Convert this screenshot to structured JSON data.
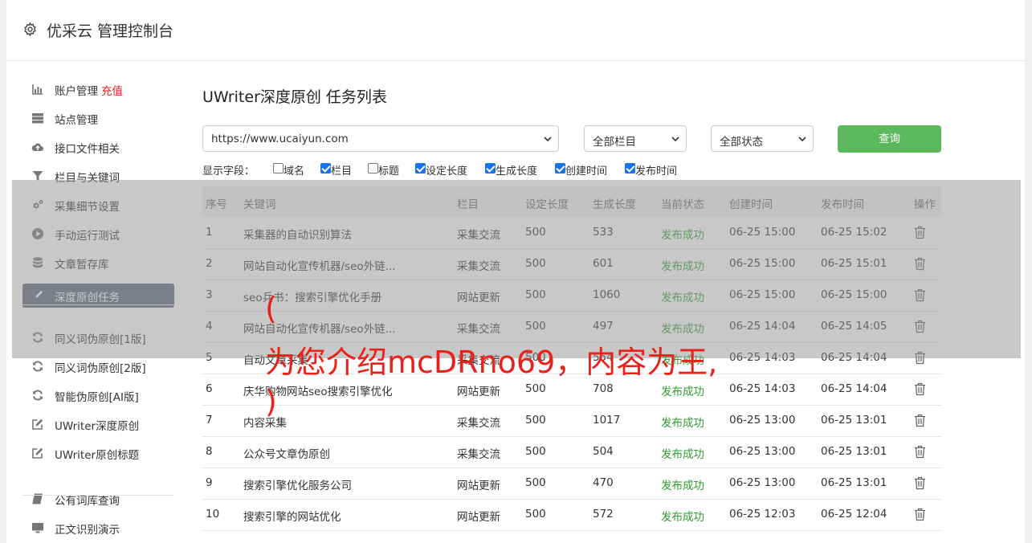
{
  "header": {
    "title": "优采云 管理控制台"
  },
  "sidebar": {
    "items": [
      {
        "label": "账户管理",
        "badge": "充值",
        "icon": "bar-chart-icon"
      },
      {
        "label": "站点管理",
        "icon": "server-icon"
      },
      {
        "label": "接口文件相关",
        "icon": "cloud-upload-icon"
      },
      {
        "label": "栏目与关键词",
        "icon": "filter-icon"
      },
      {
        "label": "采集细节设置",
        "icon": "cogs-icon"
      },
      {
        "label": "手动运行测试",
        "icon": "play-circle-icon"
      },
      {
        "label": "文章暂存库",
        "icon": "database-icon"
      },
      {
        "label": "深度原创任务",
        "icon": "edit-icon",
        "active": true
      },
      {
        "label": "同义词伪原创[1版]",
        "icon": "refresh-icon"
      },
      {
        "label": "同义词伪原创[2版]",
        "icon": "refresh-icon"
      },
      {
        "label": "智能伪原创[AI版]",
        "icon": "refresh-icon"
      },
      {
        "label": "UWriter深度原创",
        "icon": "edit-icon"
      },
      {
        "label": "UWriter原创标题",
        "icon": "edit-icon"
      },
      {
        "label": "公有词库查询",
        "icon": "book-icon"
      },
      {
        "label": "正文识别演示",
        "icon": "monitor-icon"
      }
    ]
  },
  "main": {
    "title": "UWriter深度原创 任务列表",
    "filters": {
      "site": "https://www.ucaiyun.com",
      "column": "全部栏目",
      "status": "全部状态",
      "query_button": "查询"
    },
    "fields_label": "显示字段：",
    "fields": [
      {
        "label": "域名",
        "checked": false
      },
      {
        "label": "栏目",
        "checked": true
      },
      {
        "label": "标题",
        "checked": false
      },
      {
        "label": "设定长度",
        "checked": true
      },
      {
        "label": "生成长度",
        "checked": true
      },
      {
        "label": "创建时间",
        "checked": true
      },
      {
        "label": "发布时间",
        "checked": true
      }
    ],
    "table": {
      "headers": [
        "序号",
        "关键词",
        "栏目",
        "设定长度",
        "生成长度",
        "当前状态",
        "创建时间",
        "发布时间",
        "操作"
      ],
      "rows": [
        [
          "1",
          "采集器的自动识别算法",
          "采集交流",
          "500",
          "533",
          "发布成功",
          "06-25 15:00",
          "06-25 15:02"
        ],
        [
          "2",
          "网站自动化宣传机器/seo外链...",
          "采集交流",
          "500",
          "601",
          "发布成功",
          "06-25 15:00",
          "06-25 15:01"
        ],
        [
          "3",
          "seo兵书：搜索引擎优化手册",
          "网站更新",
          "500",
          "1060",
          "发布成功",
          "06-25 15:00",
          "06-25 15:00"
        ],
        [
          "4",
          "网站自动化宣传机器/seo外链...",
          "采集交流",
          "500",
          "497",
          "发布成功",
          "06-25 14:04",
          "06-25 14:05"
        ],
        [
          "5",
          "自动文章采集",
          "采集交流",
          "500",
          "554",
          "发布成功",
          "06-25 14:03",
          "06-25 14:04"
        ],
        [
          "6",
          "庆华购物网站seo搜索引擎优化",
          "网站更新",
          "500",
          "708",
          "发布成功",
          "06-25 14:03",
          "06-25 14:04"
        ],
        [
          "7",
          "内容采集",
          "采集交流",
          "500",
          "1017",
          "发布成功",
          "06-25 13:00",
          "06-25 13:01"
        ],
        [
          "8",
          "公众号文章伪原创",
          "采集交流",
          "500",
          "504",
          "发布成功",
          "06-25 13:00",
          "06-25 13:01"
        ],
        [
          "9",
          "搜索引擎优化服务公司",
          "网站更新",
          "500",
          "470",
          "发布成功",
          "06-25 13:00",
          "06-25 13:01"
        ],
        [
          "10",
          "搜索引擎的网站优化",
          "网站更新",
          "500",
          "572",
          "发布成功",
          "06-25 12:03",
          "06-25 12:04"
        ]
      ]
    }
  },
  "watermark": {
    "line1": "(",
    "line2": "为您介绍mcDRno69，内容为王,",
    "line3": ")",
    "color": "#e8221b"
  }
}
